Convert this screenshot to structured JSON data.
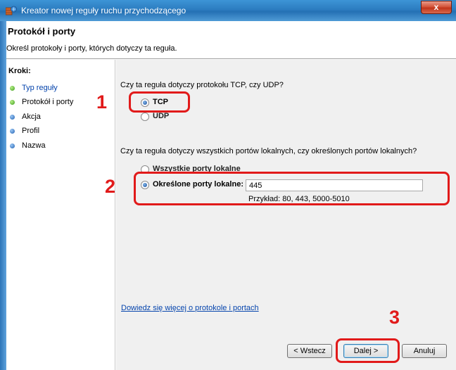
{
  "window": {
    "title": "Kreator nowej reguły ruchu przychodzącego",
    "close_label": "x"
  },
  "header": {
    "title": "Protokół i porty",
    "description": "Określ protokoły i porty, których dotyczy ta reguła."
  },
  "steps": {
    "heading": "Kroki:",
    "items": [
      {
        "label": "Typ reguły",
        "state": "done"
      },
      {
        "label": "Protokół i porty",
        "state": "current"
      },
      {
        "label": "Akcja",
        "state": "pending"
      },
      {
        "label": "Profil",
        "state": "pending"
      },
      {
        "label": "Nazwa",
        "state": "pending"
      }
    ]
  },
  "protocol": {
    "question": "Czy ta reguła dotyczy protokołu TCP, czy UDP?",
    "options": [
      {
        "label": "TCP",
        "selected": true
      },
      {
        "label": "UDP",
        "selected": false
      }
    ]
  },
  "ports": {
    "question": "Czy ta reguła dotyczy wszystkich portów lokalnych, czy określonych portów lokalnych?",
    "options": [
      {
        "label": "Wszystkie porty lokalne",
        "selected": false
      },
      {
        "label": "Określone porty lokalne:",
        "selected": true
      }
    ],
    "value": "445",
    "example": "Przykład: 80, 443, 5000-5010"
  },
  "help_link": "Dowiedz się więcej o protokole i portach",
  "buttons": {
    "back": "< Wstecz",
    "next": "Dalej >",
    "cancel": "Anuluj"
  },
  "annotations": {
    "callout_1": "1",
    "callout_2": "2",
    "callout_3": "3",
    "color": "#e11a1a"
  }
}
